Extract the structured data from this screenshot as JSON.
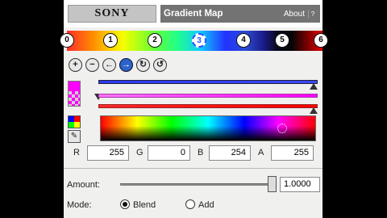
{
  "header": {
    "logo_text": "SONY",
    "title": "Gradient Map",
    "about_label": "About",
    "help_label": "?"
  },
  "gradient_stops": [
    {
      "label": "0",
      "style": "white",
      "partial": true
    },
    {
      "label": "1",
      "style": "white"
    },
    {
      "label": "2",
      "style": "white"
    },
    {
      "label": "3",
      "style": "selected"
    },
    {
      "label": "4",
      "style": "white"
    },
    {
      "label": "5",
      "style": "white"
    },
    {
      "label": "6",
      "style": "white",
      "partial": true
    }
  ],
  "tool_buttons": [
    {
      "name": "add-stop-icon",
      "glyph": "+"
    },
    {
      "name": "remove-stop-icon",
      "glyph": "−"
    },
    {
      "name": "previous-stop-icon",
      "glyph": "←"
    },
    {
      "name": "next-stop-icon",
      "glyph": "→",
      "active": true
    },
    {
      "name": "swap-left-icon",
      "glyph": "↻"
    },
    {
      "name": "swap-right-icon",
      "glyph": "↺"
    }
  ],
  "color_values": {
    "r_label": "R",
    "r_value": "255",
    "g_label": "G",
    "g_value": "0",
    "b_label": "B",
    "b_value": "254",
    "a_label": "A",
    "a_value": "255"
  },
  "amount": {
    "label": "Amount:",
    "value": "1.0000"
  },
  "mode": {
    "label": "Mode:",
    "options": [
      "Blend",
      "Add"
    ],
    "selected": "Blend"
  },
  "colors": {
    "selected_color": "#ff00fe",
    "title_bar": "#737373"
  }
}
